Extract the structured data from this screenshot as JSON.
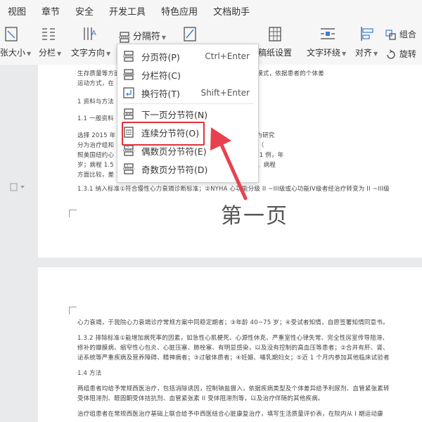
{
  "menubar": {
    "tabs": [
      "视图",
      "章节",
      "安全",
      "开发工具",
      "特色应用",
      "文档助手"
    ]
  },
  "toolbar": {
    "paper_size": "张大小",
    "columns": "分栏",
    "text_direction": "文字方向",
    "separator": "分隔符",
    "manuscript": "稿纸设置",
    "text_wrap": "文字环绕",
    "align": "对齐",
    "group": "组合",
    "rotate": "旋转"
  },
  "dropdown": {
    "items": [
      {
        "label": "分页符(P)",
        "shortcut": "Ctrl+Enter"
      },
      {
        "label": "分栏符(C)",
        "shortcut": ""
      },
      {
        "label": "换行符(T)",
        "shortcut": "Shift+Enter"
      },
      {
        "label": "下一页分节符(N)",
        "shortcut": ""
      },
      {
        "label": "连续分节符(O)",
        "shortcut": ""
      },
      {
        "label": "偶数页分节符(E)",
        "shortcut": ""
      },
      {
        "label": "奇数页分节符(D)",
        "shortcut": ""
      }
    ]
  },
  "page1": {
    "lines": [
      "生存质量等方面    我院心内科对心力衰竭患者的中西医结合心脏康复模式，依据患者的个体差",
      "运动方式，在                            ，并指导训练，现报道如下：",
      "1 资料与方法",
      "1.1 一般资料",
      "选择 2015 年                下简称“我院”）住院的慢性心力衰竭患者 100 例作为研究",
      "分为治疗组和                            ；平均年龄（62.5±10.1）岁；病程 1~7 年，平均（",
      "照美国纽约心                12 例，III级 38 例；对照组 50 例，男 29 例，女 21 例，年",
      "岁；病程 1.5                ，II 级 10 例，III 级 40 例。两组患者的性别、年龄、病程",
      "方面比较，差                究经我院医学伦理委员会审核通过。",
      "1.3.1 纳入标准①符合慢性心力衰竭诊断标准；②NYHA 心功能分级 II ~III级或心功能IV级者经治疗转变为 II ~III级"
    ],
    "watermark": "第一页"
  },
  "page2": {
    "lines": [
      "心力衰竭，于我院心力衰竭诊疗常规方案中同稳定期者；③年龄 40~75 岁；④受试者知情，自愿签署知情同意书。",
      "1.3.2 排除标准①能增加病死率的因素，如急性心肌梗死、心源性休克、严重室性心律失常、完全性房室传导阻滞、",
      "修补的瓣膜病、缩窄性心包炎、心脏压塞、肺栓塞、有明显感染，以及没有控制的高血压等患者；②合并有肝、肾、",
      "泌系统等严重疾病及营养障碍、精神病者；③过敏体质者；④妊娠、哺乳期妇女；⑤近 1 个月内参加其他临床试验者",
      "1.4 方法",
      "两组患者均给予常规西医治疗，包括消除诱因，控制钠盐摄入，依据疾病类型及个体差异给予利尿剂、血管紧张素转",
      "受体阻滞剂、醛固酮受体拮抗剂、血管紧张素 II 受体阻滞剂等，以及治疗伴随的其他疾病。",
      "治疗组患者在常规西医治疗基础上联合给予中西医结合心脏康复治疗，填写生活质量评价表，在院内从 I 期运动康"
    ]
  },
  "colors": {
    "accent": "#e0323a",
    "arrow": "#e8414d"
  }
}
